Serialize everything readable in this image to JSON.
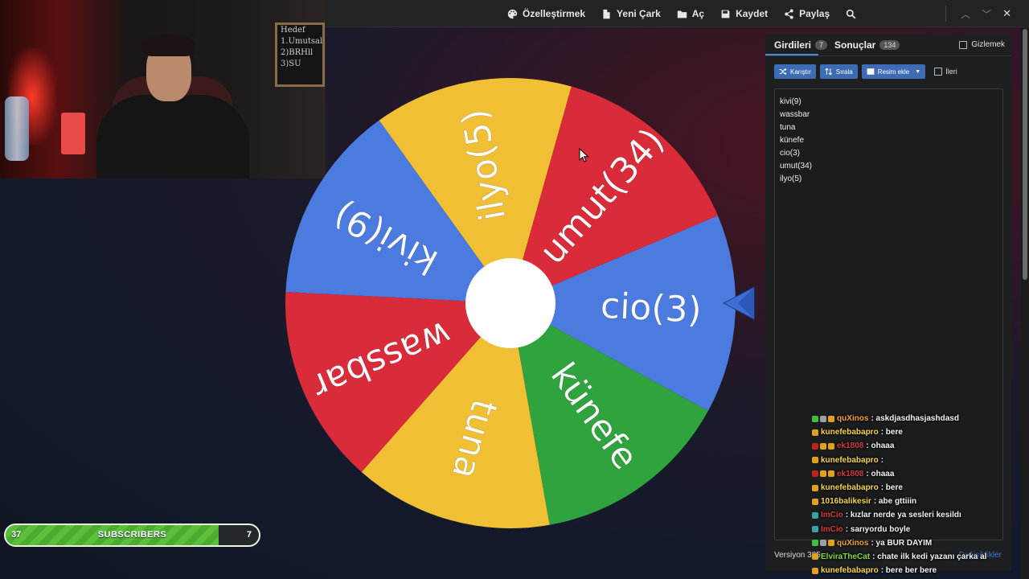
{
  "toolbar": {
    "customize": "Özelleştirmek",
    "new_wheel": "Yeni Çark",
    "open": "Aç",
    "save": "Kaydet",
    "share": "Paylaş"
  },
  "wheel": {
    "segments": [
      {
        "label": "ilyo(5)",
        "color": "#F0BF34"
      },
      {
        "label": "umut(34)",
        "color": "#D92B3A"
      },
      {
        "label": "cio(3)",
        "color": "#4C7BE0"
      },
      {
        "label": "künefe",
        "color": "#2FA33E"
      },
      {
        "label": "tuna",
        "color": "#F0BF34"
      },
      {
        "label": "wassbar",
        "color": "#D92B3A"
      },
      {
        "label": "kivi(9)",
        "color": "#4C7BE0"
      }
    ],
    "pointer_color": "#3d6fd6"
  },
  "panel": {
    "tab_entries": "Girdileri",
    "entries_count": "7",
    "tab_results": "Sonuçlar",
    "results_count": "134",
    "hide_label": "Gizlemek",
    "shuffle": "Karıştır",
    "sort": "Sırala",
    "add_image": "Resim ekle",
    "advanced": "İleri",
    "entries": [
      "kivi(9)",
      "wassbar",
      "tuna",
      "künefe",
      "cio(3)",
      "umut(34)",
      "ilyo(5)"
    ],
    "version": "Versiyon 385",
    "changes": "Değişiklikler"
  },
  "chat": [
    {
      "user": "quXinos",
      "text": ": askdjasdhasjashdasd",
      "user_color": "#f1a33a",
      "badges": [
        "#3fbf3f",
        "#9aa0a6",
        "#e0a020"
      ]
    },
    {
      "user": "kunefebabapro",
      "text": ": bere",
      "user_color": "#f7d54a",
      "badges": [
        "#e0a020"
      ]
    },
    {
      "user": "ek1808",
      "text": ": ohaaa",
      "user_color": "#d23c3c",
      "badges": [
        "#c02020",
        "#e0a020",
        "#e0a020"
      ]
    },
    {
      "user": "kunefebabapro",
      "text": ":",
      "user_color": "#f7d54a",
      "badges": [
        "#e0a020"
      ]
    },
    {
      "user": "ek1808",
      "text": ": ohaaa",
      "user_color": "#d23c3c",
      "badges": [
        "#c02020",
        "#e0a020",
        "#e0a020"
      ]
    },
    {
      "user": "kunefebabapro",
      "text": ": bere",
      "user_color": "#f7d54a",
      "badges": [
        "#e0a020"
      ]
    },
    {
      "user": "1016balikesir",
      "text": ": abe gttiiin",
      "user_color": "#f7d54a",
      "badges": [
        "#e0a020"
      ]
    },
    {
      "user": "ImCio",
      "text": ": kızlar nerde ya sesleri kesildı",
      "user_color": "#d23c3c",
      "badges": [
        "#3aa0a0"
      ]
    },
    {
      "user": "ImCio",
      "text": ": sarıyordu boyle",
      "user_color": "#d23c3c",
      "badges": [
        "#3aa0a0"
      ]
    },
    {
      "user": "quXinos",
      "text": ": ya BUR DAYIM",
      "user_color": "#f1a33a",
      "badges": [
        "#3fbf3f",
        "#9aa0a6",
        "#e0a020"
      ]
    },
    {
      "user": "ElviraTheCat",
      "text": ": chate ilk kedi yazanı çarka al",
      "user_color": "#7cd94a",
      "badges": [
        "#e0a020"
      ]
    },
    {
      "user": "kunefebabapro",
      "text": ": bere ber bere",
      "user_color": "#f7d54a",
      "badges": [
        "#e0a020"
      ]
    }
  ],
  "webcam": {
    "board_lines": [
      "Hedef",
      "1.Umutsal",
      "2)BRHll",
      "3)SU"
    ]
  },
  "subscribers": {
    "current": "37",
    "label": "SUBSCRIBERS",
    "remaining": "7",
    "progress": 0.84
  }
}
